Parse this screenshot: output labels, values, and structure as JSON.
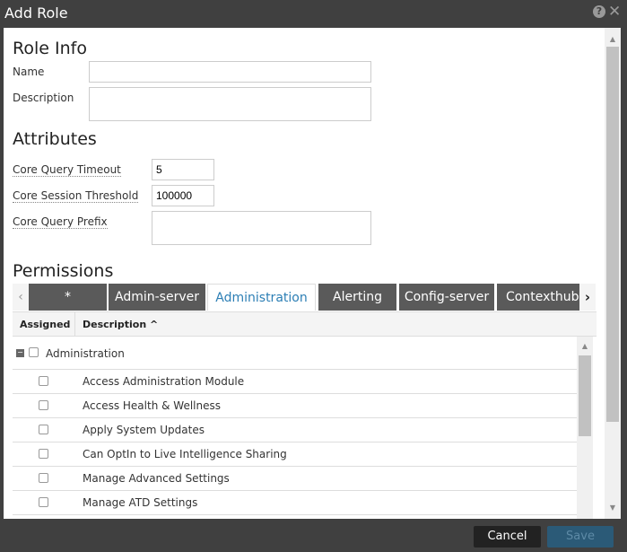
{
  "dialog": {
    "title": "Add Role",
    "help_icon": "question-circle",
    "close_icon": "close-x"
  },
  "role_info": {
    "heading": "Role Info",
    "name_label": "Name",
    "name_value": "",
    "description_label": "Description",
    "description_value": ""
  },
  "attributes": {
    "heading": "Attributes",
    "fields": [
      {
        "label": "Core Query Timeout",
        "value": "5"
      },
      {
        "label": "Core Session Threshold",
        "value": "100000"
      },
      {
        "label": "Core Query Prefix",
        "value": ""
      }
    ]
  },
  "permissions": {
    "heading": "Permissions",
    "tabs": [
      {
        "label": "*"
      },
      {
        "label": "Admin-server"
      },
      {
        "label": "Administration",
        "active": true
      },
      {
        "label": "Alerting"
      },
      {
        "label": "Config-server"
      },
      {
        "label": "Contexthub-"
      }
    ],
    "columns": {
      "assigned": "Assigned",
      "description": "Description ^"
    },
    "group": {
      "label": "Administration",
      "checked": false
    },
    "rows": [
      {
        "label": "Access Administration Module",
        "checked": false
      },
      {
        "label": "Access Health & Wellness",
        "checked": false
      },
      {
        "label": "Apply System Updates",
        "checked": false
      },
      {
        "label": "Can OptIn to Live Intelligence Sharing",
        "checked": false
      },
      {
        "label": "Manage Advanced Settings",
        "checked": false
      },
      {
        "label": "Manage ATD Settings",
        "checked": false
      }
    ]
  },
  "footer": {
    "cancel": "Cancel",
    "save": "Save"
  },
  "colors": {
    "frame": "#404040",
    "accent": "#2d7fb5",
    "save_disabled": "#2b5a77"
  }
}
